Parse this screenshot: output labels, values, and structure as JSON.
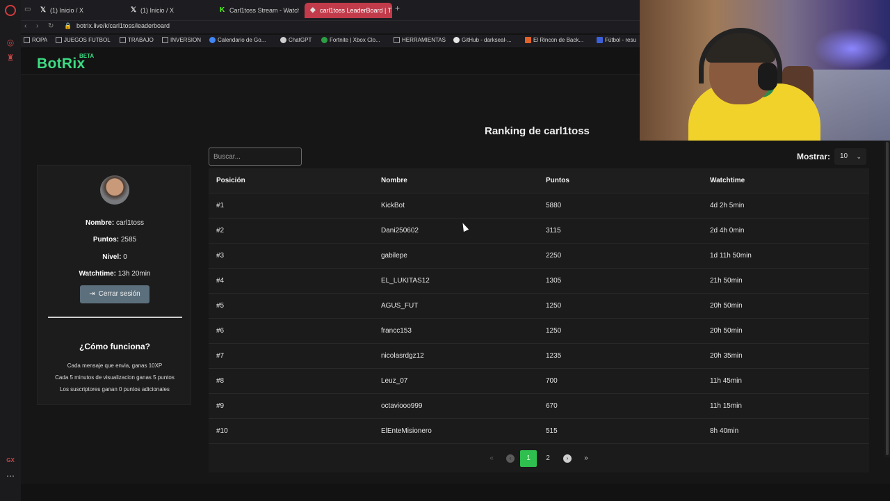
{
  "browser": {
    "tabs": [
      {
        "label": "(1) Inicio / X",
        "favicon": "x-icon"
      },
      {
        "label": "(1) Inicio / X",
        "favicon": "x-icon"
      },
      {
        "label": "Carl1toss Stream - Watch",
        "favicon": "kick-icon"
      },
      {
        "label": "carl1toss LeaderBoard | T",
        "favicon": "botrix-icon",
        "active": true
      }
    ],
    "url": "botrix.live/k/carl1toss/leaderboard",
    "bookmarks": [
      {
        "label": "ROPA"
      },
      {
        "label": "JUEGOS FUTBOL"
      },
      {
        "label": "TRABAJO"
      },
      {
        "label": "INVERSION"
      },
      {
        "label": "Calendario de Go..."
      },
      {
        "label": "ChatGPT"
      },
      {
        "label": "Fortnite | Xbox Clo..."
      },
      {
        "label": "HERRAMIENTAS"
      },
      {
        "label": "GitHub - darkseal-..."
      },
      {
        "label": "El Rincon de Back..."
      },
      {
        "label": "Fútbol - resu"
      }
    ],
    "sidebar_gx": "GX"
  },
  "site": {
    "brand": "BotRix",
    "badge": "BETA",
    "accent": "#3ddc84"
  },
  "leaderboard": {
    "title": "Ranking de carl1toss",
    "search_placeholder": "Buscar...",
    "show_label": "Mostrar:",
    "show_value": "10",
    "columns": [
      "Posición",
      "Nombre",
      "Puntos",
      "Watchtime"
    ],
    "rows": [
      [
        "#1",
        "KickBot",
        "5880",
        "4d 2h 5min"
      ],
      [
        "#2",
        "Dani250602",
        "3115",
        "2d 4h 0min"
      ],
      [
        "#3",
        "gabilepe",
        "2250",
        "1d 11h 50min"
      ],
      [
        "#4",
        "EL_LUKITAS12",
        "1305",
        "21h 50min"
      ],
      [
        "#5",
        "AGUS_FUT",
        "1250",
        "20h 50min"
      ],
      [
        "#6",
        "francc153",
        "1250",
        "20h 50min"
      ],
      [
        "#7",
        "nicolasrdgz12",
        "1235",
        "20h 35min"
      ],
      [
        "#8",
        "Leuz_07",
        "700",
        "11h 45min"
      ],
      [
        "#9",
        "octaviooo999",
        "670",
        "11h 15min"
      ],
      [
        "#10",
        "ElEnteMisionero",
        "515",
        "8h 40min"
      ]
    ],
    "pagination": {
      "pages": [
        "1",
        "2"
      ],
      "current": "1"
    }
  },
  "profile": {
    "name_label": "Nombre:",
    "name": "carl1toss",
    "points_label": "Puntos:",
    "points": "2585",
    "level_label": "Nivel:",
    "level": "0",
    "watch_label": "Watchtime:",
    "watchtime": "13h 20min",
    "logout": "Cerrar sesión",
    "how_title": "¿Cómo funciona?",
    "how_lines": [
      "Cada mensaje que envia, ganas 10XP",
      "Cada 5 minutos de visualizacion ganas 5 puntos",
      "Los suscriptores ganan 0 puntos adicionales"
    ]
  }
}
